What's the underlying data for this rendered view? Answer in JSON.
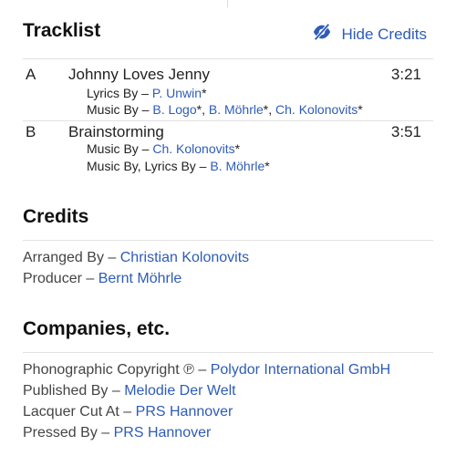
{
  "tracklist": {
    "heading": "Tracklist",
    "hide_credits_label": "Hide Credits",
    "tracks": [
      {
        "position": "A",
        "title": "Johnny Loves Jenny",
        "duration": "3:21",
        "lyrics_role": "Lyrics By –",
        "lyrics_artist": "P. Unwin",
        "music_role": "Music By –",
        "music_artist_1": "B. Logo",
        "music_artist_2": "B. Möhrle",
        "music_artist_3": "Ch. Kolonovits"
      },
      {
        "position": "B",
        "title": "Brainstorming",
        "duration": "3:51",
        "music_role": "Music By –",
        "music_artist": "Ch. Kolonovits",
        "music_lyrics_role": "Music By, Lyrics By –",
        "music_lyrics_artist": "B. Möhrle"
      }
    ]
  },
  "credits": {
    "heading": "Credits",
    "items": [
      {
        "role": "Arranged By –",
        "name": "Christian Kolonovits"
      },
      {
        "role": "Producer –",
        "name": "Bernt Möhrle"
      }
    ]
  },
  "companies": {
    "heading": "Companies, etc.",
    "items": [
      {
        "role": "Phonographic Copyright ℗ –",
        "name": "Polydor International GmbH"
      },
      {
        "role": "Published By –",
        "name": "Melodie Der Welt"
      },
      {
        "role": "Lacquer Cut At –",
        "name": "PRS Hannover"
      },
      {
        "role": "Pressed By –",
        "name": "PRS Hannover"
      }
    ]
  },
  "colors": {
    "link": "#2e5cb8",
    "text": "#1a1a1a",
    "divider": "#e1e1e1"
  }
}
